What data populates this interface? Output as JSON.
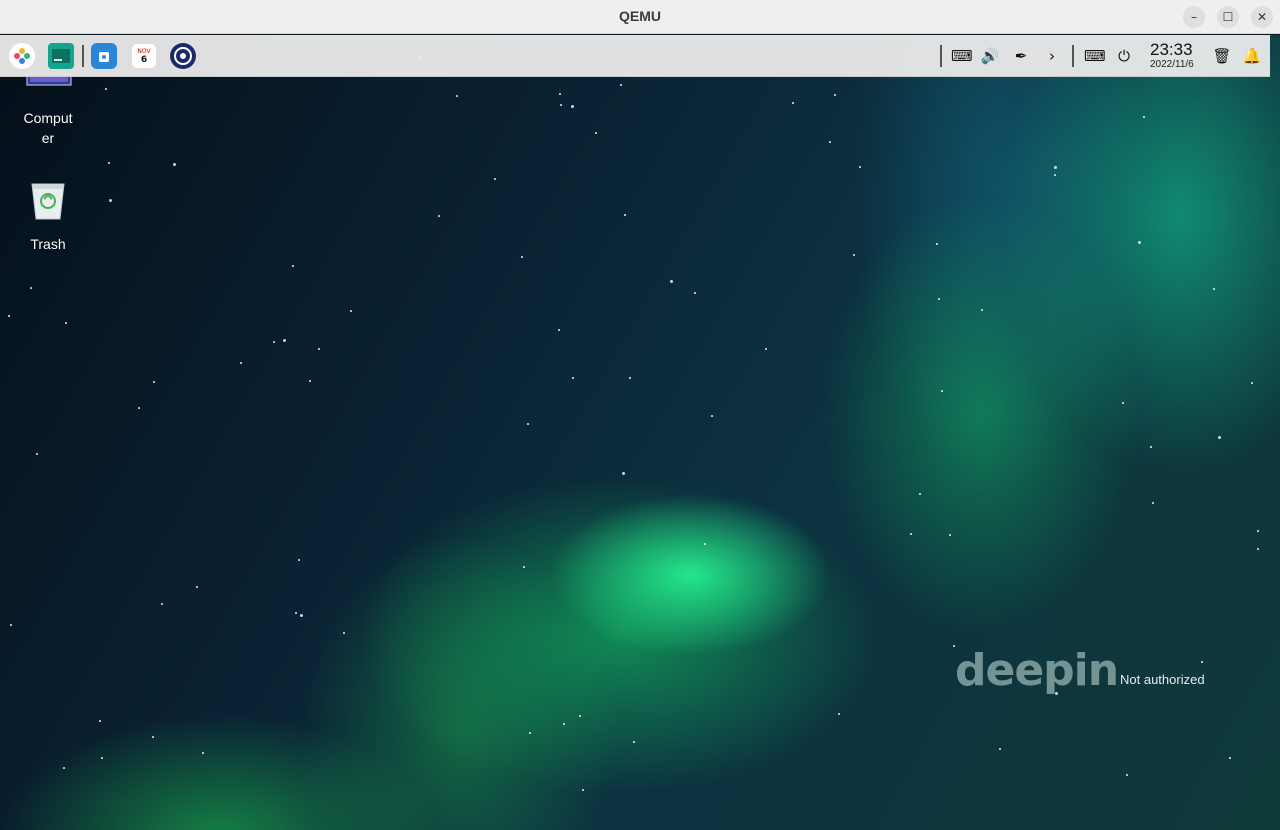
{
  "window": {
    "title": "QEMU"
  },
  "window_buttons": {
    "minimize": "–",
    "maximize": "☐",
    "close": "✕"
  },
  "dock": {
    "apps": [
      {
        "name": "launcher-icon"
      },
      {
        "name": "terminal-icon"
      },
      {
        "name": "app-store-icon"
      },
      {
        "name": "calendar-icon",
        "month": "NOV",
        "day": "6"
      },
      {
        "name": "control-center-icon"
      }
    ],
    "tray": {
      "keyboard_icon": "⌨",
      "volume_icon": "🔊",
      "pen_icon": "✒",
      "expand_icon": "›",
      "onscreen_keyboard_icon": "⌨",
      "power_icon": "⏻",
      "trash_icon": "🗑",
      "notification_icon": "🔔"
    },
    "clock": {
      "time": "23:33",
      "date": "2022/11/6"
    }
  },
  "desktop": {
    "icons": [
      {
        "label": "Computer",
        "label_line1": "Comput",
        "label_line2": "er"
      },
      {
        "label": "Trash"
      }
    ]
  },
  "watermark": {
    "logo": "deepin",
    "status": "Not authorized"
  },
  "colors": {
    "dock_bg": "#e8e8e8",
    "titlebar_bg": "#f0efee",
    "aurora": "#28ff96"
  }
}
